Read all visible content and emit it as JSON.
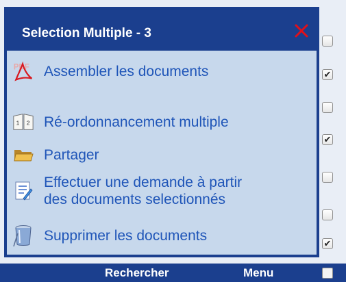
{
  "popup": {
    "title": "Selection Multiple - 3",
    "close_icon": "close-icon",
    "items": [
      {
        "label": "Assembler les documents",
        "icon": "pdf-icon"
      },
      {
        "label": "Ré-ordonnancement multiple",
        "icon": "reorder-pages-icon"
      },
      {
        "label": "Partager",
        "icon": "folder-icon"
      },
      {
        "label_line1": "Effectuer une demande à partir",
        "label_line2": "des documents selectionnés",
        "icon": "request-form-icon"
      },
      {
        "label": "Supprimer les documents",
        "icon": "trash-icon"
      }
    ]
  },
  "checkboxes": [
    {
      "checked": false
    },
    {
      "checked": true
    },
    {
      "checked": false
    },
    {
      "checked": true
    },
    {
      "checked": false
    },
    {
      "checked": false
    },
    {
      "checked": true
    },
    {
      "checked": false
    }
  ],
  "bottom_bar": {
    "search_label": "Rechercher",
    "menu_label": "Menu"
  },
  "colors": {
    "popup_header": "#1b3f8e",
    "popup_body": "#c7d8ec",
    "item_text": "#1f55b8",
    "close_x": "#e0101a"
  }
}
